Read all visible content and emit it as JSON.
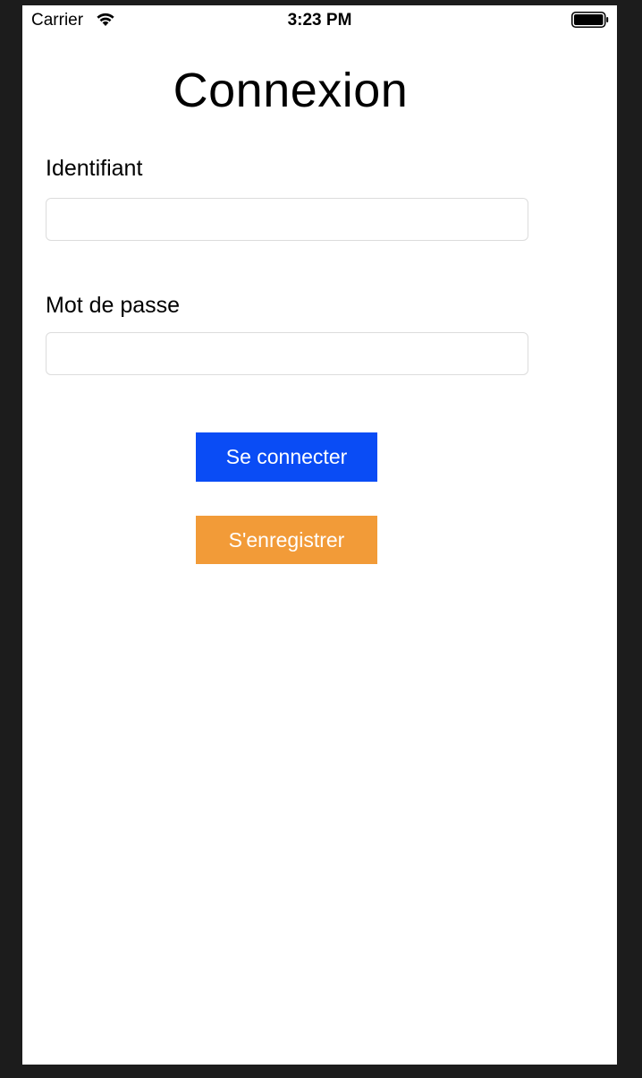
{
  "status_bar": {
    "carrier": "Carrier",
    "time": "3:23 PM",
    "icons": [
      "wifi-icon",
      "battery-icon"
    ]
  },
  "title": "Connexion",
  "form": {
    "username": {
      "label": "Identifiant",
      "value": "",
      "placeholder": ""
    },
    "password": {
      "label": "Mot de passe",
      "value": "",
      "placeholder": ""
    }
  },
  "buttons": {
    "login": {
      "label": "Se connecter",
      "color": "#0a4cf5"
    },
    "register": {
      "label": "S'enregistrer",
      "color": "#f29b38"
    }
  }
}
